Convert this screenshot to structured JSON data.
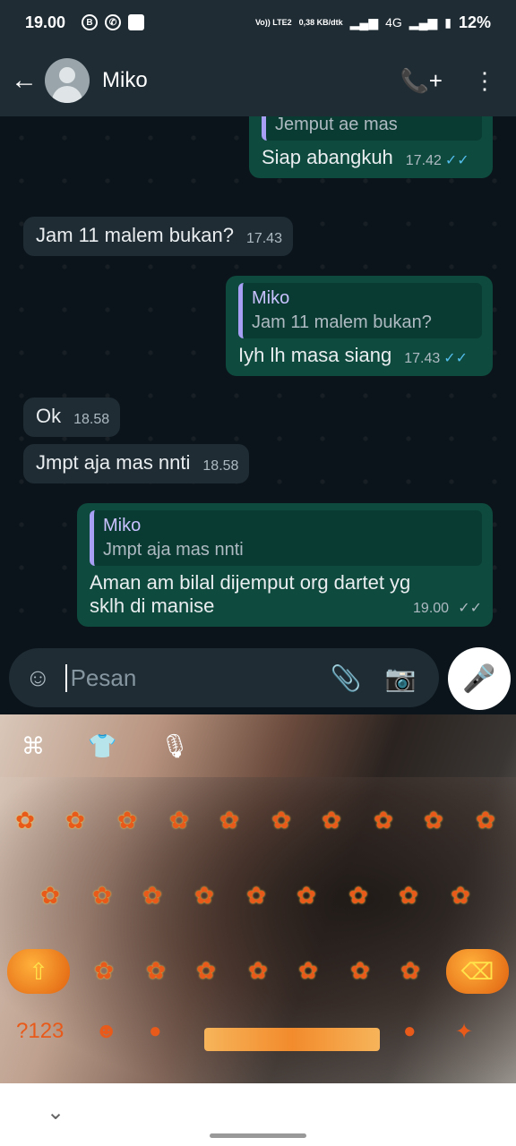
{
  "status": {
    "time": "19.00",
    "app_icons": [
      "B",
      "whatsapp",
      "bag"
    ],
    "volte": "Vo)) LTE2",
    "speed": "0,38 KB/dtk",
    "network": "4G",
    "battery": "12%"
  },
  "header": {
    "contact_name": "Miko",
    "icons": [
      "back-arrow-icon",
      "avatar",
      "add-call-icon",
      "more-vert-icon"
    ]
  },
  "messages": [
    {
      "dir": "out",
      "quote_name": "",
      "quote_text": "Jemput ae mas",
      "text": "Siap abangkuh",
      "time": "17.42",
      "status": "read"
    },
    {
      "dir": "in",
      "text": "Jam 11 malem bukan?",
      "time": "17.43"
    },
    {
      "dir": "out",
      "quote_name": "Miko",
      "quote_text": "Jam 11 malem bukan?",
      "text": "Iyh lh masa siang",
      "time": "17.43",
      "status": "read"
    },
    {
      "dir": "in",
      "text": "Ok",
      "time": "18.58"
    },
    {
      "dir": "in",
      "text": "Jmpt aja mas nnti",
      "time": "18.58"
    },
    {
      "dir": "out",
      "quote_name": "Miko",
      "quote_text": "Jmpt aja mas nnti",
      "text_line1": "Aman am bilal dijemput org dartet yg",
      "text_line2": "sklh di manise",
      "time": "19.00",
      "status": "delivered"
    }
  ],
  "input": {
    "placeholder": "Pesan"
  },
  "icons": {
    "back": "←",
    "add_call": "📞+",
    "more": "⋮",
    "emoji": "☺",
    "attach": "📎",
    "camera": "📷",
    "mic": "🎤",
    "read_ticks": "✓✓",
    "chevron": "⌄"
  },
  "keyboard": {
    "shift_symbol": "⇧",
    "delete_symbol": "⌫",
    "mode_label": "?123"
  },
  "colors": {
    "header_bg": "#1f2c34",
    "chat_bg": "#0b141a",
    "incoming_bubble": "#1f2c34",
    "outgoing_bubble": "#0e4a3e",
    "quote_bar": "#a79ff4",
    "read_tick": "#53bdeb"
  }
}
